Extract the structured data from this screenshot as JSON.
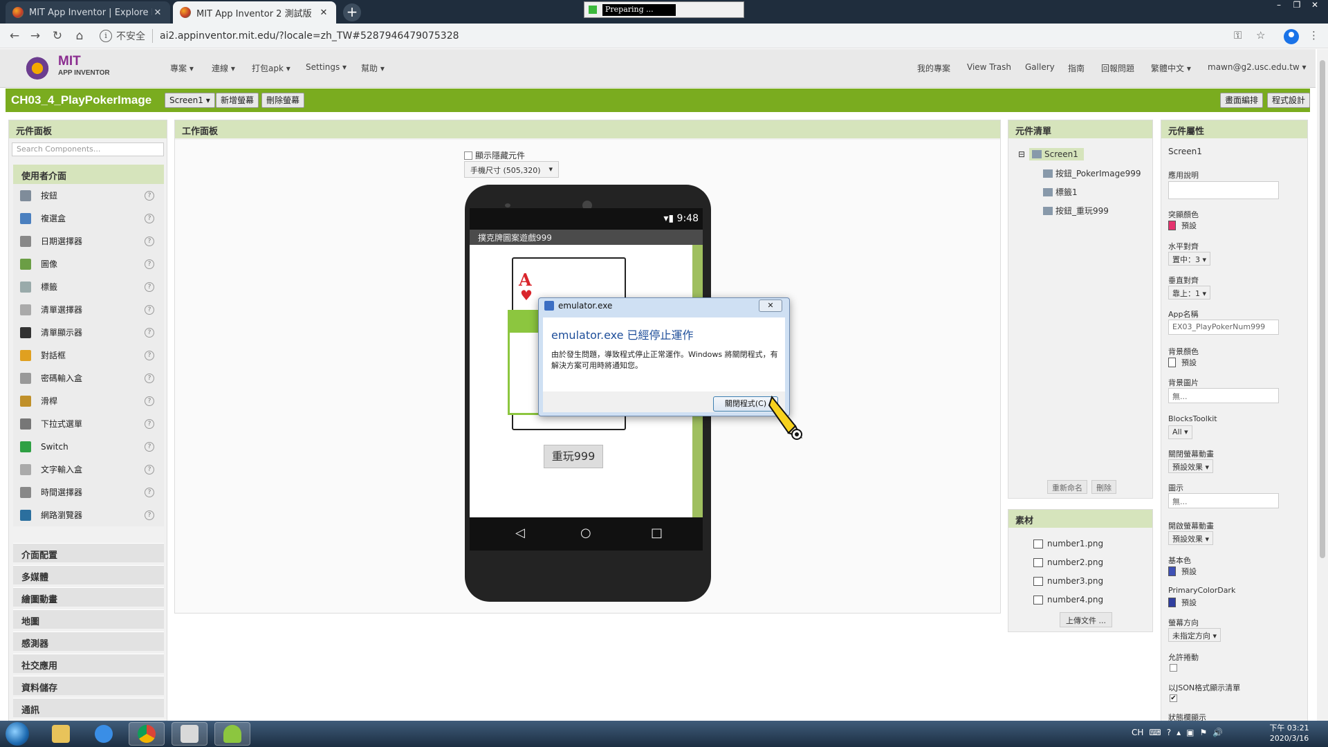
{
  "browser": {
    "tabs": [
      {
        "title": "MIT App Inventor | Explore MIT",
        "active": false
      },
      {
        "title": "MIT App Inventor 2 測試版",
        "active": true
      }
    ],
    "new_tab": "+",
    "preparing": "Preparing ...",
    "url": "ai2.appinventor.mit.edu/?locale=zh_TW#5287946479075328",
    "insecure_label": "不安全",
    "win_controls": [
      "–",
      "❐",
      "✕"
    ]
  },
  "header": {
    "logo_mit": "MIT",
    "logo_sub": "APP INVENTOR",
    "left_menu": [
      "專案 ▾",
      "連線 ▾",
      "打包apk ▾",
      "Settings ▾",
      "幫助 ▾"
    ],
    "right_menu": [
      "我的專案",
      "View Trash",
      "Gallery",
      "指南",
      "回報問題",
      "繁體中文 ▾",
      "mawn@g2.usc.edu.tw ▾"
    ]
  },
  "project": {
    "name": "CH03_4_PlayPokerImage",
    "screen_select": "Screen1 ▾",
    "add_screen": "新增螢幕",
    "remove_screen": "刪除螢幕",
    "designer": "畫面編排",
    "blocks": "程式設計"
  },
  "palette": {
    "title": "元件面板",
    "search_placeholder": "Search Components...",
    "open_category": "使用者介面",
    "components": [
      "按鈕",
      "複選盒",
      "日期選擇器",
      "圖像",
      "標籤",
      "清單選擇器",
      "清單顯示器",
      "對話框",
      "密碼輸入盒",
      "滑桿",
      "下拉式選單",
      "Switch",
      "文字輸入盒",
      "時間選擇器",
      "網路瀏覽器"
    ],
    "help_glyph": "?",
    "categories": [
      "介面配置",
      "多媒體",
      "繪圖動畫",
      "地圖",
      "感測器",
      "社交應用",
      "資料儲存",
      "通訊"
    ]
  },
  "viewer": {
    "title": "工作面板",
    "hidden_checkbox": "顯示隱藏元件",
    "size_select": "手機尺寸 (505,320)",
    "status_time": "9:48",
    "app_title": "撲克牌圖案遊戲999",
    "card_rank": "A",
    "card_suit": "♥",
    "replay_button": "重玩999",
    "nav_back": "◁",
    "nav_home": "○",
    "nav_recent": "□"
  },
  "tree": {
    "title": "元件清單",
    "collapse": "⊟",
    "root": "Screen1",
    "children": [
      "按鈕_PokerImage999",
      "標籤1",
      "按鈕_重玩999"
    ],
    "rename": "重新命名",
    "delete": "刪除"
  },
  "media": {
    "title": "素材",
    "assets": [
      "number1.png",
      "number2.png",
      "number3.png",
      "number4.png"
    ],
    "upload": "上傳文件 ..."
  },
  "props": {
    "title": "元件屬性",
    "component": "Screen1",
    "items": {
      "about_label": "應用說明",
      "accent_label": "突顯顏色",
      "accent_value": "預設",
      "halign_label": "水平對齊",
      "halign_value": "置中：3 ▾",
      "valign_label": "垂直對齊",
      "valign_value": "靠上：1 ▾",
      "appname_label": "App名稱",
      "appname_value": "EX03_PlayPokerNum999",
      "bgcolor_label": "背景顏色",
      "bgcolor_value": "預設",
      "bgimage_label": "背景圖片",
      "bgimage_value": "無...",
      "blocks_label": "BlocksToolkit",
      "blocks_value": "All ▾",
      "close_anim_label": "關閉螢幕動畫",
      "close_anim_value": "預設效果 ▾",
      "icon_label": "圖示",
      "icon_value": "無...",
      "open_anim_label": "開啟螢幕動畫",
      "open_anim_value": "預設效果 ▾",
      "primary_label": "基本色",
      "primary_value": "預設",
      "primary_dark_label": "PrimaryColorDark",
      "primary_dark_value": "預設",
      "orientation_label": "螢幕方向",
      "orientation_value": "未指定方向 ▾",
      "scroll_label": "允許捲動",
      "json_label": "以JSON格式顯示清單",
      "json_check": "✔",
      "cut_label": "狀態欄顯示"
    },
    "colors": {
      "accent": "#e5336e",
      "bg": "#ffffff",
      "primary": "#3f51b5",
      "primary_dark": "#303f9f"
    }
  },
  "error_dialog": {
    "title": "emulator.exe",
    "close_glyph": "✕",
    "heading": "emulator.exe 已經停止運作",
    "message": "由於發生問題，導致程式停止正常運作。Windows 將關閉程式，有解決方案可用時將通知您。",
    "button": "關閉程式(C)"
  },
  "taskbar": {
    "tray": [
      "CH",
      "⌨",
      "?",
      "▴",
      "▣",
      "⚑",
      "🔊"
    ],
    "time": "下午 03:21",
    "date": "2020/3/16"
  }
}
